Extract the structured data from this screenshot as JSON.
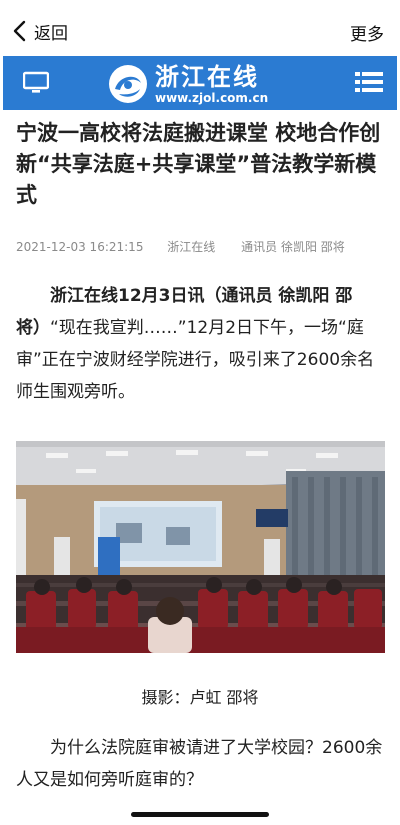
{
  "nav": {
    "back_label": "返回",
    "more_label": "更多"
  },
  "header": {
    "brand_name": "浙江在线",
    "brand_url": "www.zjol.com.cn",
    "color": "#2b7bd2",
    "left_icon": "tv-icon",
    "right_icon": "menu-list-icon"
  },
  "article": {
    "title": "宁波一高校将法庭搬进课堂 校地合作创新“共享法庭+共享课堂”普法教学新模式",
    "date": "2021-12-03 16:21:15",
    "source": "浙江在线",
    "authors": "通讯员 徐凯阳 邵将",
    "lead_bold": "浙江在线12月3日讯（通讯员 徐凯阳 邵将）",
    "lead_text": "“现在我宣判……”12月2日下午，一场“庭审”正在宁波财经学院进行，吸引来了2600余名师生围观旁听。",
    "photo_caption": "摄影：卢虹 邵将",
    "paragraph2": "为什么法院庭审被请进了大学校园？2600余人又是如何旁听庭审的？"
  }
}
